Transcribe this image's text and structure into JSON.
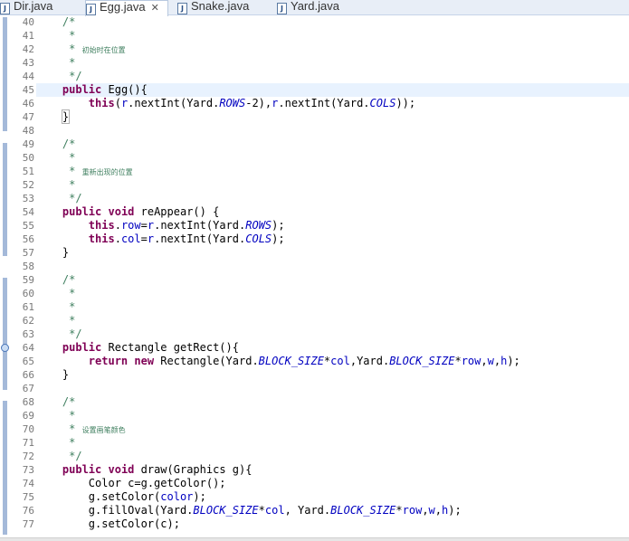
{
  "tabs": [
    {
      "label": "Dir.java",
      "active": false
    },
    {
      "label": "Egg.java",
      "active": true
    },
    {
      "label": "Snake.java",
      "active": false
    },
    {
      "label": "Yard.java",
      "active": false
    }
  ],
  "editor": {
    "current_line": 45,
    "override_marker_line": 64,
    "lines": [
      {
        "n": "40",
        "tokens": [
          [
            "    ",
            ""
          ],
          [
            "/*",
            "cm"
          ]
        ]
      },
      {
        "n": "41",
        "tokens": [
          [
            "     *",
            "cm"
          ]
        ]
      },
      {
        "n": "42",
        "tokens": [
          [
            "     * ",
            "cm"
          ],
          [
            "初始时在位置",
            "cmcjk"
          ]
        ]
      },
      {
        "n": "43",
        "tokens": [
          [
            "     *",
            "cm"
          ]
        ]
      },
      {
        "n": "44",
        "tokens": [
          [
            "     */",
            "cm"
          ]
        ]
      },
      {
        "n": "45",
        "tokens": [
          [
            "    ",
            ""
          ],
          [
            "public",
            "kw"
          ],
          [
            " Egg(){",
            ""
          ]
        ]
      },
      {
        "n": "46",
        "tokens": [
          [
            "        ",
            ""
          ],
          [
            "this",
            "kw"
          ],
          [
            "(",
            ""
          ],
          [
            "r",
            "fld"
          ],
          [
            ".nextInt(Yard.",
            ""
          ],
          [
            "ROWS",
            "sfld"
          ],
          [
            "-2),",
            ""
          ],
          [
            "r",
            "fld"
          ],
          [
            ".nextInt(Yard.",
            ""
          ],
          [
            "COLS",
            "sfld"
          ],
          [
            "));",
            ""
          ]
        ]
      },
      {
        "n": "47",
        "tokens": [
          [
            "    ",
            ""
          ],
          [
            "}",
            "br"
          ]
        ]
      },
      {
        "n": "48",
        "tokens": []
      },
      {
        "n": "49",
        "tokens": [
          [
            "    ",
            ""
          ],
          [
            "/*",
            "cm"
          ]
        ]
      },
      {
        "n": "50",
        "tokens": [
          [
            "     *",
            "cm"
          ]
        ]
      },
      {
        "n": "51",
        "tokens": [
          [
            "     * ",
            "cm"
          ],
          [
            "重新出现的位置",
            "cmcjk"
          ]
        ]
      },
      {
        "n": "52",
        "tokens": [
          [
            "     *",
            "cm"
          ]
        ]
      },
      {
        "n": "53",
        "tokens": [
          [
            "     */",
            "cm"
          ]
        ]
      },
      {
        "n": "54",
        "tokens": [
          [
            "    ",
            ""
          ],
          [
            "public",
            "kw"
          ],
          [
            " ",
            ""
          ],
          [
            "void",
            "kw"
          ],
          [
            " reAppear() {",
            ""
          ]
        ]
      },
      {
        "n": "55",
        "tokens": [
          [
            "        ",
            ""
          ],
          [
            "this",
            "kw"
          ],
          [
            ".",
            ""
          ],
          [
            "row",
            "fld"
          ],
          [
            "=",
            ""
          ],
          [
            "r",
            "fld"
          ],
          [
            ".nextInt(Yard.",
            ""
          ],
          [
            "ROWS",
            "sfld"
          ],
          [
            ");",
            ""
          ]
        ]
      },
      {
        "n": "56",
        "tokens": [
          [
            "        ",
            ""
          ],
          [
            "this",
            "kw"
          ],
          [
            ".",
            ""
          ],
          [
            "col",
            "fld"
          ],
          [
            "=",
            ""
          ],
          [
            "r",
            "fld"
          ],
          [
            ".nextInt(Yard.",
            ""
          ],
          [
            "COLS",
            "sfld"
          ],
          [
            ");",
            ""
          ]
        ]
      },
      {
        "n": "57",
        "tokens": [
          [
            "    }",
            ""
          ]
        ]
      },
      {
        "n": "58",
        "tokens": []
      },
      {
        "n": "59",
        "tokens": [
          [
            "    ",
            ""
          ],
          [
            "/*",
            "cm"
          ]
        ]
      },
      {
        "n": "60",
        "tokens": [
          [
            "     *",
            "cm"
          ]
        ]
      },
      {
        "n": "61",
        "tokens": [
          [
            "     *",
            "cm"
          ]
        ]
      },
      {
        "n": "62",
        "tokens": [
          [
            "     *",
            "cm"
          ]
        ]
      },
      {
        "n": "63",
        "tokens": [
          [
            "     */",
            "cm"
          ]
        ]
      },
      {
        "n": "64",
        "tokens": [
          [
            "    ",
            ""
          ],
          [
            "public",
            "kw"
          ],
          [
            " Rectangle getRect(){",
            ""
          ]
        ]
      },
      {
        "n": "65",
        "tokens": [
          [
            "        ",
            ""
          ],
          [
            "return",
            "kw"
          ],
          [
            " ",
            ""
          ],
          [
            "new",
            "kw"
          ],
          [
            " Rectangle(Yard.",
            ""
          ],
          [
            "BLOCK_SIZE",
            "sfld"
          ],
          [
            "*",
            ""
          ],
          [
            "col",
            "fld"
          ],
          [
            ",Yard.",
            ""
          ],
          [
            "BLOCK_SIZE",
            "sfld"
          ],
          [
            "*",
            ""
          ],
          [
            "row",
            "fld"
          ],
          [
            ",",
            ""
          ],
          [
            "w",
            "fld"
          ],
          [
            ",",
            ""
          ],
          [
            "h",
            "fld"
          ],
          [
            ");",
            ""
          ]
        ]
      },
      {
        "n": "66",
        "tokens": [
          [
            "    }",
            ""
          ]
        ]
      },
      {
        "n": "67",
        "tokens": []
      },
      {
        "n": "68",
        "tokens": [
          [
            "    ",
            ""
          ],
          [
            "/*",
            "cm"
          ]
        ]
      },
      {
        "n": "69",
        "tokens": [
          [
            "     *",
            "cm"
          ]
        ]
      },
      {
        "n": "70",
        "tokens": [
          [
            "     * ",
            "cm"
          ],
          [
            "设置画笔颜色",
            "cmcjk"
          ]
        ]
      },
      {
        "n": "71",
        "tokens": [
          [
            "     *",
            "cm"
          ]
        ]
      },
      {
        "n": "72",
        "tokens": [
          [
            "     */",
            "cm"
          ]
        ]
      },
      {
        "n": "73",
        "tokens": [
          [
            "    ",
            ""
          ],
          [
            "public",
            "kw"
          ],
          [
            " ",
            ""
          ],
          [
            "void",
            "kw"
          ],
          [
            " draw(Graphics g){",
            ""
          ]
        ]
      },
      {
        "n": "74",
        "tokens": [
          [
            "        Color c=g.getColor();",
            ""
          ]
        ]
      },
      {
        "n": "75",
        "tokens": [
          [
            "        g.setColor(",
            ""
          ],
          [
            "color",
            "fld"
          ],
          [
            ");",
            ""
          ]
        ]
      },
      {
        "n": "76",
        "tokens": [
          [
            "        g.fillOval(Yard.",
            ""
          ],
          [
            "BLOCK_SIZE",
            "sfld"
          ],
          [
            "*",
            ""
          ],
          [
            "col",
            "fld"
          ],
          [
            ", Yard.",
            ""
          ],
          [
            "BLOCK_SIZE",
            "sfld"
          ],
          [
            "*",
            ""
          ],
          [
            "row",
            "fld"
          ],
          [
            ",",
            ""
          ],
          [
            "w",
            "fld"
          ],
          [
            ",",
            ""
          ],
          [
            "h",
            "fld"
          ],
          [
            ");",
            ""
          ]
        ]
      },
      {
        "n": "77",
        "tokens": [
          [
            "        g.setColor(c);",
            ""
          ]
        ]
      }
    ]
  }
}
